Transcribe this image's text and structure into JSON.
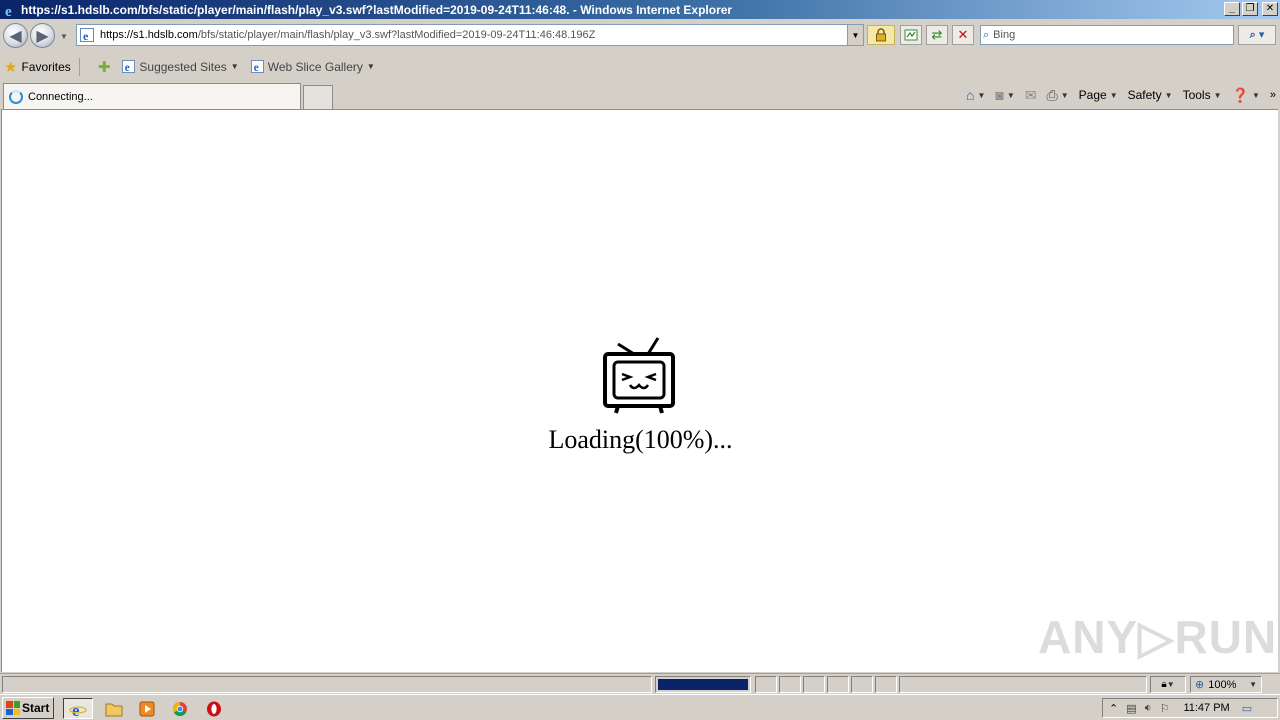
{
  "window": {
    "title": "https://s1.hdslb.com/bfs/static/player/main/flash/play_v3.swf?lastModified=2019-09-24T11:46:48. - Windows Internet Explorer",
    "minimize": "_",
    "maximize": "❐",
    "close": "✕"
  },
  "address_bar": {
    "url_scheme_host": "https://s1.hdslb.com",
    "url_path": "/bfs/static/player/main/flash/play_v3.swf?lastModified=2019-09-24T11:46:48.196Z"
  },
  "search": {
    "placeholder": "Bing"
  },
  "favorites_bar": {
    "favorites_label": "Favorites",
    "items": [
      {
        "label": "Suggested Sites"
      },
      {
        "label": "Web Slice Gallery"
      }
    ]
  },
  "tab": {
    "title": "Connecting..."
  },
  "command_bar": {
    "page": "Page",
    "safety": "Safety",
    "tools": "Tools"
  },
  "content": {
    "loading_text": "Loading(100%)...",
    "watermark": "ANY▷RUN"
  },
  "status_bar": {
    "zoom": "100%",
    "progress_fraction": 1.0
  },
  "taskbar": {
    "start_label": "Start",
    "clock": "11:47 PM"
  },
  "colors": {
    "titlebar_start": "#0a246a",
    "progress_fill": "#0a246a",
    "page_background": "#ffffff"
  }
}
